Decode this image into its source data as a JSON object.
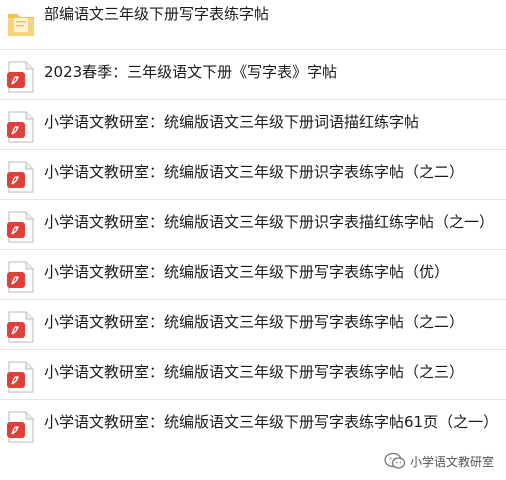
{
  "files": [
    {
      "type": "folder",
      "name": "部编语文三年级下册写字表练字帖"
    },
    {
      "type": "pdf",
      "name": "2023春季：三年级语文下册《写字表》字帖"
    },
    {
      "type": "pdf",
      "name": "小学语文教研室：统编版语文三年级下册词语描红练字帖"
    },
    {
      "type": "pdf",
      "name": "小学语文教研室：统编版语文三年级下册识字表练字帖（之二）"
    },
    {
      "type": "pdf",
      "name": "小学语文教研室：统编版语文三年级下册识字表描红练字帖（之一）"
    },
    {
      "type": "pdf",
      "name": "小学语文教研室：统编版语文三年级下册写字表练字帖（优）"
    },
    {
      "type": "pdf",
      "name": "小学语文教研室：统编版语文三年级下册写字表练字帖（之二）"
    },
    {
      "type": "pdf",
      "name": "小学语文教研室：统编版语文三年级下册写字表练字帖（之三）"
    },
    {
      "type": "pdf",
      "name": "小学语文教研室：统编版语文三年级下册写字表练字帖61页（之一）"
    }
  ],
  "watermark": {
    "text": "小学语文教研室",
    "icon": "wechat-icon"
  },
  "colors": {
    "folder": "#f5c04a",
    "pdf": "#e0403a",
    "divider": "#e6e6e6"
  }
}
